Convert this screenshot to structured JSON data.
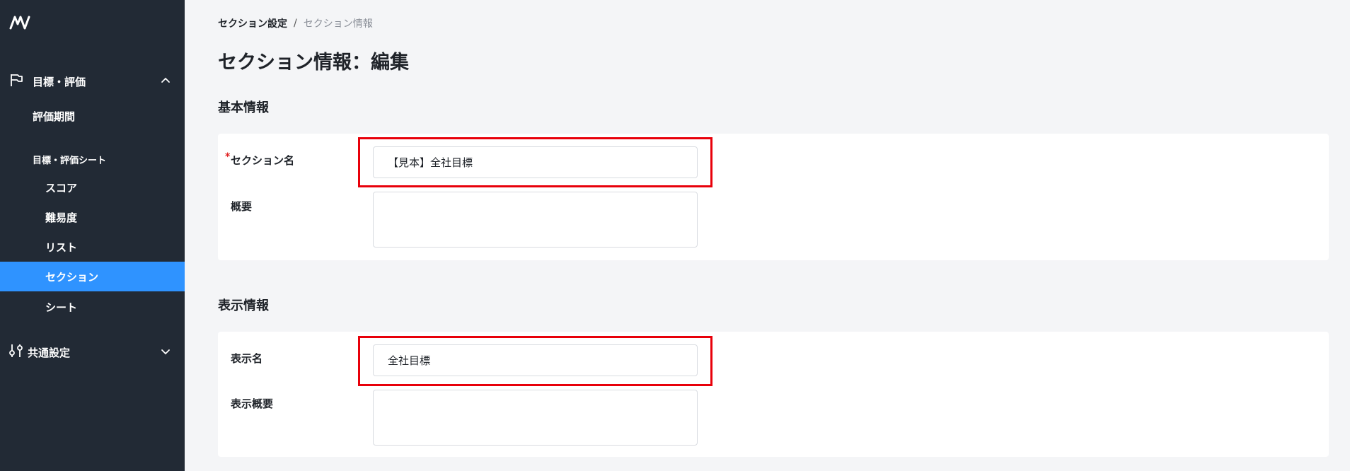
{
  "sidebar": {
    "logo": "M-logo-icon",
    "groups": [
      {
        "label": "目標・評価",
        "icon": "flag-icon",
        "expanded": true
      },
      {
        "label": "共通設定",
        "icon": "sliders-icon",
        "expanded": false
      }
    ],
    "items": {
      "evaluation_period": "評価期間",
      "sheet_header": "目標・評価シート",
      "score": "スコア",
      "difficulty": "難易度",
      "list": "リスト",
      "section": "セクション",
      "sheet": "シート"
    },
    "active_item": "セクション",
    "colors": {
      "background": "#222a35",
      "active": "#2f93ff"
    }
  },
  "breadcrumb": {
    "parent": "セクション設定",
    "separator": "/",
    "current": "セクション情報"
  },
  "page": {
    "title": "セクション情報：編集"
  },
  "basic_info": {
    "title": "基本情報",
    "section_name": {
      "label": "セクション名",
      "required_mark": "*",
      "value": "【見本】全社目標"
    },
    "summary": {
      "label": "概要",
      "value": ""
    }
  },
  "display_info": {
    "title": "表示情報",
    "display_name": {
      "label": "表示名",
      "value": "全社目標"
    },
    "display_summary": {
      "label": "表示概要",
      "value": ""
    }
  },
  "accent_colors": {
    "highlight": "#e8000a",
    "required": "#e02020"
  }
}
